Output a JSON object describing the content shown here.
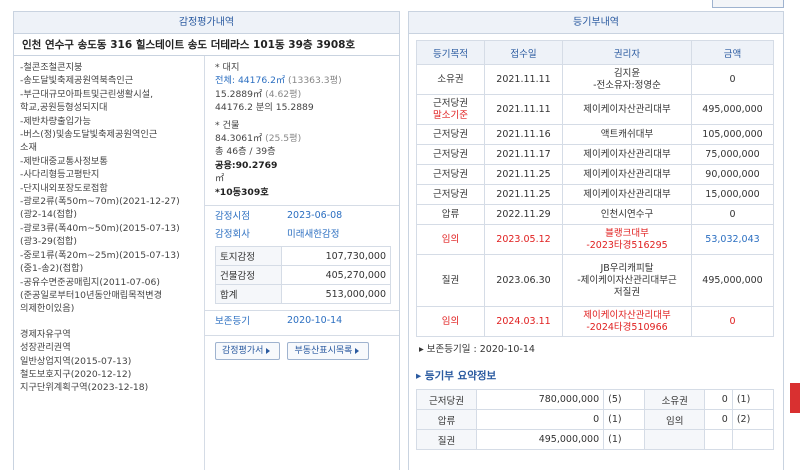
{
  "left": {
    "title": "감정평가내역",
    "address": "인천 연수구 송도동 316 힐스테이트 송도 더테라스 101동 39층 3908호",
    "zoning": [
      "-철콘조철콘지붕",
      "-송도달빛축제공원역북측인근",
      "-부근대규모아파트및근린생활시설,",
      "학교,공원등형성되지대",
      "-제반차량출입가능",
      "-버스(정)및송도달빛축제공원역인근",
      "소재",
      "-제반대중교통사정보통",
      "-사다리형등고평탄지",
      "-단지내외포장도로접함",
      "-광로2류(폭50m~70m)(2021-12-27)",
      "(광2-14(접합)",
      "-광로3류(폭40m~50m)(2015-07-13)",
      "(광3-29(접합)",
      "-중로1류(폭20m~25m)(2015-07-13)",
      "(중1-송2)(접합)",
      "-공유수면준공매립지(2011-07-06)",
      "(준공일로부터10년동안매립목적변경",
      "의제한이있음)"
    ],
    "zoning2": [
      "경제자유구역",
      "성장관리권역",
      "일반상업지역(2015-07-13)",
      "철도보호지구(2020-12-12)",
      "지구단위계획구역(2023-12-18)"
    ],
    "land_label": "* 대지",
    "land_total_label": "전체:",
    "land_total": "44176.2㎡",
    "land_total_py": "(13363.3평)",
    "land_share": "15.2889㎡",
    "land_share_py": "(4.62평)",
    "land_ratio": "44176.2 분의 15.2889",
    "bldg_label": "* 건물",
    "bldg_area": "84.3061㎡",
    "bldg_area_py": "(25.5평)",
    "floors": "총 46층 / 39층",
    "common": "공용:90.2769",
    "common_unit": "㎡",
    "unit": "*10동309호",
    "appraisal_date_label": "감정시점",
    "appraisal_date": "2023-06-08",
    "appraiser_label": "감정회사",
    "appraiser": "미래새한감정",
    "values": [
      {
        "label": "토지감정",
        "value": "107,730,000"
      },
      {
        "label": "건물감정",
        "value": "405,270,000"
      },
      {
        "label": "합계",
        "value": "513,000,000"
      }
    ],
    "preserve_label": "보존등기",
    "preserve_date": "2020-10-14",
    "btn_appraisal": "감정평가서",
    "btn_registry": "부동산표시목록"
  },
  "right": {
    "title": "등기부내역",
    "headers": [
      "등기목적",
      "접수일",
      "권리자",
      "금액"
    ],
    "rows": [
      {
        "purpose": "소유권",
        "date": "2021.11.11",
        "holder": "김지윤\n-전소유자:정영순",
        "amount": "0",
        "red": false
      },
      {
        "purpose": "근저당권\n말소기준",
        "date": "2021.11.11",
        "holder": "제이케이자산관리대부",
        "amount": "495,000,000",
        "red": false,
        "base": true
      },
      {
        "purpose": "근저당권",
        "date": "2021.11.16",
        "holder": "액트캐쉬대부",
        "amount": "105,000,000",
        "red": false
      },
      {
        "purpose": "근저당권",
        "date": "2021.11.17",
        "holder": "제이케이자산관리대부",
        "amount": "75,000,000",
        "red": false
      },
      {
        "purpose": "근저당권",
        "date": "2021.11.25",
        "holder": "제이케이자산관리대부",
        "amount": "90,000,000",
        "red": false
      },
      {
        "purpose": "근저당권",
        "date": "2021.11.25",
        "holder": "제이케이자산관리대부",
        "amount": "15,000,000",
        "red": false
      },
      {
        "purpose": "압류",
        "date": "2022.11.29",
        "holder": "인천시연수구",
        "amount": "0",
        "red": false
      },
      {
        "purpose": "임의",
        "date": "2023.05.12",
        "holder": "블랭크대부\n-2023타경516295",
        "amount": "53,032,043",
        "red": true
      },
      {
        "purpose": "질권",
        "date": "2023.06.30",
        "holder": "JB우리캐피탈\n-제이케이자산관리대부근\n저질권",
        "amount": "495,000,000",
        "red": false
      },
      {
        "purpose": "임의",
        "date": "2024.03.11",
        "holder": "제이케이자산관리대부\n-2024타경510966",
        "amount": "0",
        "red": true
      }
    ],
    "preserve_line": "▸ 보존등기일 : 2020-10-14",
    "summary_title": "▸ 등기부 요약정보",
    "summary": [
      {
        "l1": "근저당권",
        "v1": "780,000,000",
        "c1": "(5)",
        "l2": "소유권",
        "v2": "0",
        "c2": "(1)"
      },
      {
        "l1": "압류",
        "v1": "0",
        "c1": "(1)",
        "l2": "임의",
        "v2": "0",
        "c2": "(2)"
      },
      {
        "l1": "질권",
        "v1": "495,000,000",
        "c1": "(1)",
        "l2": "",
        "v2": "",
        "c2": ""
      }
    ]
  }
}
